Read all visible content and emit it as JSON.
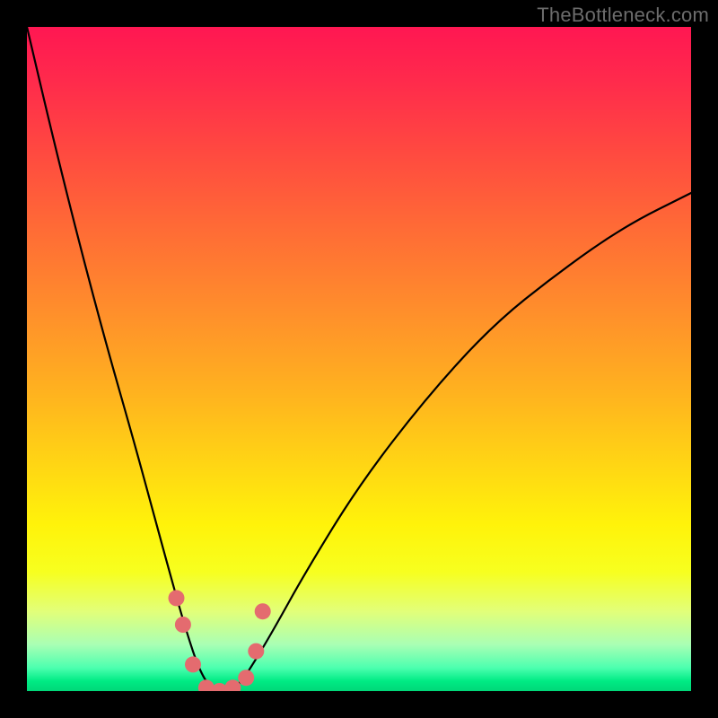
{
  "watermark": "TheBottleneck.com",
  "colors": {
    "frame": "#000000",
    "curve": "#000000",
    "marker": "#e46b6f",
    "gradient_top": "#ff1752",
    "gradient_bottom": "#00d779"
  },
  "chart_data": {
    "type": "line",
    "title": "",
    "xlabel": "",
    "ylabel": "",
    "xlim": [
      0,
      100
    ],
    "ylim": [
      0,
      100
    ],
    "grid": false,
    "note": "Background vertical gradient encodes bottleneck severity: red/top ≈ high, green/bottom ≈ low. Curve dips to near-zero around x≈27–33 then rises.",
    "series": [
      {
        "name": "bottleneck-curve",
        "x": [
          0,
          4,
          8,
          12,
          16,
          19,
          22,
          24,
          26,
          28,
          30,
          32,
          34,
          37,
          42,
          50,
          60,
          70,
          80,
          90,
          100
        ],
        "y": [
          100,
          83,
          67,
          52,
          38,
          27,
          16,
          9,
          3,
          0,
          0,
          1,
          4,
          9,
          18,
          31,
          44,
          55,
          63,
          70,
          75
        ]
      }
    ],
    "markers": {
      "name": "highlighted-points",
      "x": [
        22.5,
        23.5,
        25,
        27,
        29,
        31,
        33,
        34.5,
        35.5
      ],
      "y": [
        14,
        10,
        4,
        0.5,
        0,
        0.5,
        2,
        6,
        12
      ]
    }
  }
}
